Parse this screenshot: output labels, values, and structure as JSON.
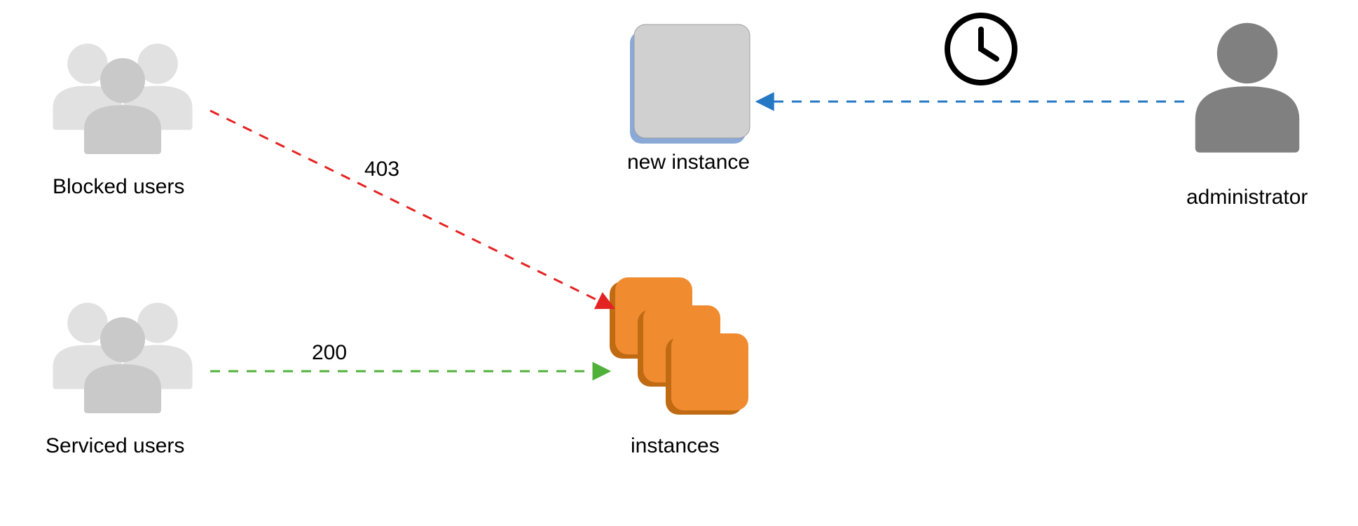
{
  "nodes": {
    "blocked_users": {
      "label": "Blocked users"
    },
    "serviced_users": {
      "label": "Serviced users"
    },
    "new_instance": {
      "label": "new instance"
    },
    "instances": {
      "label": "instances"
    },
    "administrator": {
      "label": "administrator"
    }
  },
  "edges": {
    "blocked_to_instances": {
      "label": "403"
    },
    "serviced_to_instances": {
      "label": "200"
    }
  },
  "colors": {
    "user_light": "#c9c9c9",
    "user_dark": "#808080",
    "instance_fill": "#f08c2f",
    "instance_edge": "#c06a13",
    "newbox_fill": "#d0d0d0",
    "newbox_side": "#8aa9d6",
    "arrow_red": "#e52222",
    "arrow_green": "#4fb13a",
    "arrow_blue": "#2478c4",
    "clock": "#000000"
  }
}
